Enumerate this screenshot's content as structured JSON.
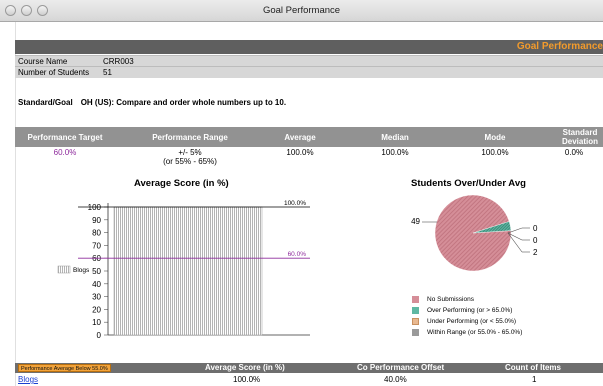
{
  "window": {
    "title": "Goal Performance"
  },
  "header": {
    "title": "Goal Performance"
  },
  "course": {
    "name_label": "Course Name",
    "name_value": "CRR003",
    "students_label": "Number of Students",
    "students_value": "51"
  },
  "standard": {
    "label": "Standard/Goal",
    "value": "OH (US): Compare and order whole numbers up to 10."
  },
  "performance": {
    "headers": [
      "Performance Target",
      "Performance Range",
      "Average",
      "Median",
      "Mode",
      "Standard Deviation"
    ],
    "target": "60.0%",
    "range_line1": "+/- 5%",
    "range_line2": "(or 55% - 65%)",
    "average": "100.0%",
    "median": "100.0%",
    "mode": "100.0%",
    "std_dev": "0.0%"
  },
  "chart_data": [
    {
      "type": "bar",
      "title": "Average Score (in %)",
      "categories": [
        "Blogs"
      ],
      "series": [
        {
          "name": "Blogs",
          "values": [
            100
          ]
        }
      ],
      "ylim": [
        0,
        100
      ],
      "yticks": [
        "100",
        "90",
        "80",
        "70",
        "60",
        "50",
        "40",
        "30",
        "20",
        "10",
        "0"
      ],
      "reference_lines": [
        {
          "value": 100,
          "label": "100.0%",
          "color": "#000000"
        },
        {
          "value": 60,
          "label": "60.0%",
          "color": "#8e2a9c"
        }
      ],
      "legend": {
        "position": "left"
      }
    },
    {
      "type": "pie",
      "title": "Students Over/Under Avg",
      "labels": [
        "No Submissions",
        "Over Performing (or > 65.0%)",
        "Under Performing (or < 55.0%)",
        "Within Range (or 55.0% - 65.0%)"
      ],
      "values": [
        49,
        0,
        0,
        2
      ],
      "colors": [
        "#d58e98",
        "#5fb8a3",
        "#e8b890",
        "#9a9a9a"
      ],
      "legend": {
        "position": "bottom"
      }
    }
  ],
  "bottom_table": {
    "badge": "Performance Average Below 55.0%",
    "headers": [
      "Average Score (in %)",
      "Co⁠ Performance Offset",
      "Count of Items"
    ],
    "row": {
      "name": "Blogs",
      "average": "100.0%",
      "offset": "40.0%",
      "count": "1"
    }
  },
  "colors": {
    "header_accent": "#f29b2c",
    "target_text": "#8e2a9c",
    "link": "#1a3fd1"
  }
}
